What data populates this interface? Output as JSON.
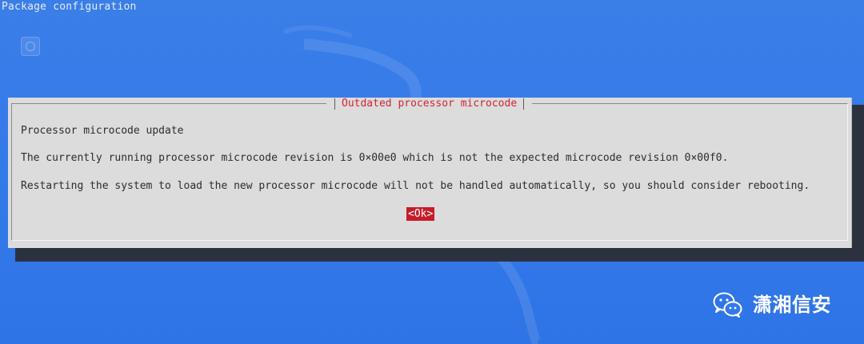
{
  "header": {
    "title": "Package configuration"
  },
  "dialog": {
    "title": "Outdated processor microcode",
    "lines": [
      "Processor microcode update",
      "The currently running processor microcode revision is 0×00e0 which is not the expected microcode revision 0×00f0.",
      "Restarting the system to load the new processor microcode will not be handled automatically, so you should consider rebooting."
    ],
    "ok_label": "<Ok>"
  },
  "watermark": {
    "text": "潇湘信安",
    "icon": "wechat-icon"
  },
  "colors": {
    "background": "#3479ea",
    "dialog_bg": "#dcdcdc",
    "title_red": "#cf2431",
    "button_red": "#c31d2a",
    "shadow": "#2c3140"
  }
}
